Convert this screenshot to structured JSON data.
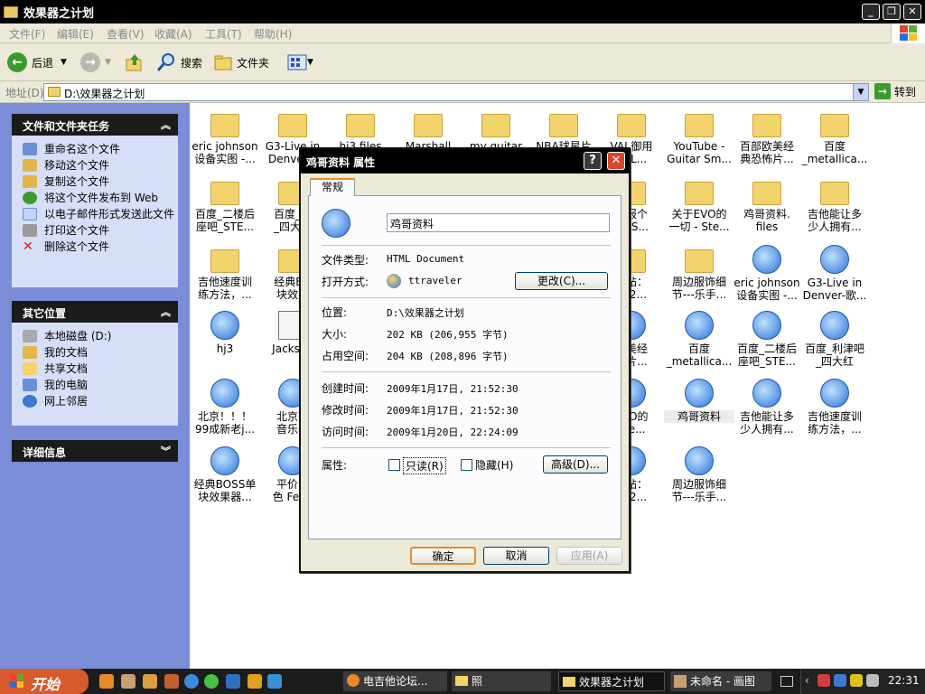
{
  "window": {
    "title": "效果器之计划"
  },
  "menubar": {
    "items": [
      "文件(F)",
      "编辑(E)",
      "查看(V)",
      "收藏(A)",
      "工具(T)",
      "帮助(H)"
    ]
  },
  "toolbar": {
    "back": "后退",
    "search": "搜索",
    "folders": "文件夹"
  },
  "address": {
    "label": "地址(D)",
    "value": "D:\\效果器之计划",
    "go": "转到"
  },
  "left_panel": {
    "tasks": {
      "title": "文件和文件夹任务",
      "items": [
        "重命名这个文件",
        "移动这个文件",
        "复制这个文件",
        "将这个文件发布到 Web",
        "以电子邮件形式发送此文件",
        "打印这个文件",
        "删除这个文件"
      ]
    },
    "places": {
      "title": "其它位置",
      "items": [
        "本地磁盘 (D:)",
        "我的文档",
        "共享文档",
        "我的电脑",
        "网上邻居"
      ]
    },
    "details": {
      "title": "详细信息"
    }
  },
  "files": [
    {
      "l1": "eric johnson",
      "l2": "设备实图 -..."
    },
    {
      "l1": "G3-Live in",
      "l2": "Denver..."
    },
    {
      "l1": "hj3 files",
      "l2": ""
    },
    {
      "l1": "Marshall",
      "l2": ""
    },
    {
      "l1": "my guitar",
      "l2": ""
    },
    {
      "l1": "NBA球星片",
      "l2": ""
    },
    {
      "l1": "VAI 御用",
      "l2": "IN L..."
    },
    {
      "l1": "YouTube -",
      "l2": "Guitar Sm..."
    },
    {
      "l1": "百部欧美经",
      "l2": "典恐怖片..."
    },
    {
      "l1": "百度",
      "l2": "_metallica..."
    },
    {
      "l1": "百度_二楼后",
      "l2": "座吧_STE..."
    },
    {
      "l1": "百度_利",
      "l2": "_四大红"
    },
    {
      "l1": "家报个",
      "l2": "be S..."
    },
    {
      "l1": "关于EVO的",
      "l2": "一切 - Ste..."
    },
    {
      "l1": "鸡哥资料.",
      "l2": "files"
    },
    {
      "l1": "吉他能让多",
      "l2": "少人拥有..."
    },
    {
      "l1": "吉他速度训",
      "l2": "练方法，..."
    },
    {
      "l1": "经典BO",
      "l2": "块效果"
    },
    {
      "l1": "读帖：",
      "l2": "ST2..."
    },
    {
      "l1": "周边服饰细",
      "l2": "节---乐手..."
    },
    {
      "l1": "eric johnson",
      "l2": "设备实图 -..."
    },
    {
      "l1": "G3-Live in",
      "l2": "Denver-歌..."
    },
    {
      "l1": "hj3",
      "l2": ""
    },
    {
      "l1": "Jackson",
      "l2": ""
    },
    {
      "l1": "欧美经",
      "l2": "怖片..."
    },
    {
      "l1": "百度",
      "l2": "_metallica..."
    },
    {
      "l1": "百度_二楼后",
      "l2": "座吧_STE..."
    },
    {
      "l1": "百度_利津吧",
      "l2": "_四大红"
    },
    {
      "l1": "北京！！！",
      "l2": "99成新老j..."
    },
    {
      "l1": "北京豪",
      "l2": "音乐器"
    },
    {
      "l1": "EVO的",
      "l2": "Ste..."
    },
    {
      "l1": "鸡哥资料",
      "l2": ""
    },
    {
      "l1": "吉他能让多",
      "l2": "少人拥有..."
    },
    {
      "l1": "吉他速度训",
      "l2": "练方法，..."
    },
    {
      "l1": "经典BOSS单",
      "l2": "块效果器..."
    },
    {
      "l1": "平价出",
      "l2": "色 Fend"
    },
    {
      "l1": "读帖：",
      "l2": "ST2..."
    },
    {
      "l1": "周边服饰细",
      "l2": "节---乐手..."
    }
  ],
  "dialog": {
    "title": "鸡哥资料 属性",
    "tab": "常规",
    "name_value": "鸡哥资料",
    "type_label": "文件类型:",
    "type_value": "HTML Document",
    "open_label": "打开方式:",
    "open_value": "ttraveler",
    "change_button": "更改(C)...",
    "location_label": "位置:",
    "location_value": "D:\\效果器之计划",
    "size_label": "大小:",
    "size_value": "202 KB (206,955 字节)",
    "disk_label": "占用空间:",
    "disk_value": "204 KB (208,896 字节)",
    "created_label": "创建时间:",
    "created_value": "2009年1月17日, 21:52:30",
    "modified_label": "修改时间:",
    "modified_value": "2009年1月17日, 21:52:30",
    "accessed_label": "访问时间:",
    "accessed_value": "2009年1月20日, 22:24:09",
    "attr_label": "属性:",
    "readonly": "只读(R)",
    "hidden": "隐藏(H)",
    "advanced_button": "高级(D)...",
    "ok": "确定",
    "cancel": "取消",
    "apply": "应用(A)"
  },
  "taskbar": {
    "start": "开始",
    "tasks": [
      "电吉他论坛...",
      "照",
      "效果器之计划",
      "未命名 - 画图"
    ],
    "clock": "22:31"
  },
  "colors": {
    "accent": "#e68b2c",
    "panel_bg": "#d6dff7",
    "left_bg": "#7a8dd6",
    "close_red": "#d8472c"
  }
}
